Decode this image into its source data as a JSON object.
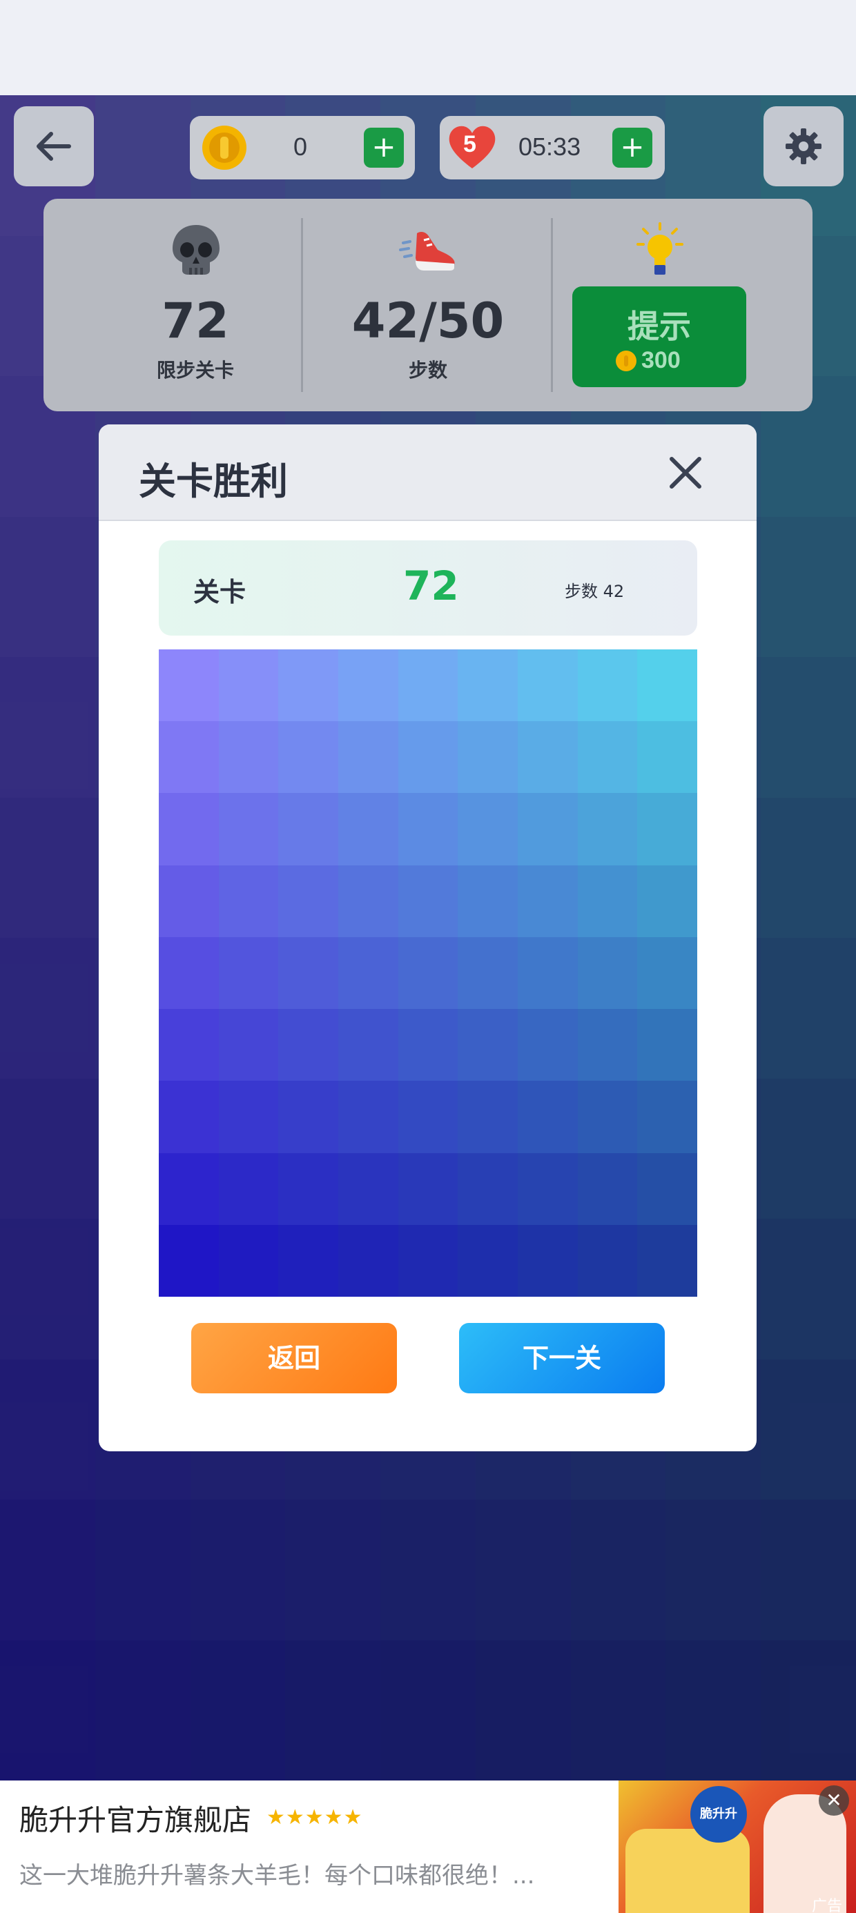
{
  "top_bar": {
    "coins": "0",
    "lives": "5",
    "timer": "05:33",
    "plus_label": "+"
  },
  "stats": {
    "level": "72",
    "level_label": "限步关卡",
    "steps": "42/50",
    "steps_label": "步数",
    "hint_label": "提示",
    "hint_cost": "300"
  },
  "modal": {
    "title": "关卡胜利",
    "level_label": "关卡",
    "level_value": "72",
    "steps_text": "步数 42",
    "back_button": "返回",
    "next_button": "下一关",
    "grid": {
      "rows": 9,
      "cols": 9,
      "top_left": "#8d86fb",
      "top_right": "#54d0eb",
      "bottom_left": "#1f16c6",
      "bottom_right": "#1e3c9c"
    }
  },
  "board": {
    "rows": 12,
    "cols": 9,
    "top_left": "#6e5ad8",
    "top_right": "#41a8b8",
    "bottom_left": "#1e15a8",
    "bottom_right": "#1b2f86"
  },
  "ad": {
    "title": "脆升升官方旗舰店",
    "stars": "★★★★★",
    "description": "这一大堆脆升升薯条大羊毛！每个口味都很绝！...",
    "brand_text": "脆升升",
    "tag": "广告",
    "close": "✕"
  },
  "colors": {
    "green": "#1a9b45",
    "orange": "#ff8a1e",
    "blue": "#0a8cf5",
    "level_green": "#1eb45a"
  }
}
